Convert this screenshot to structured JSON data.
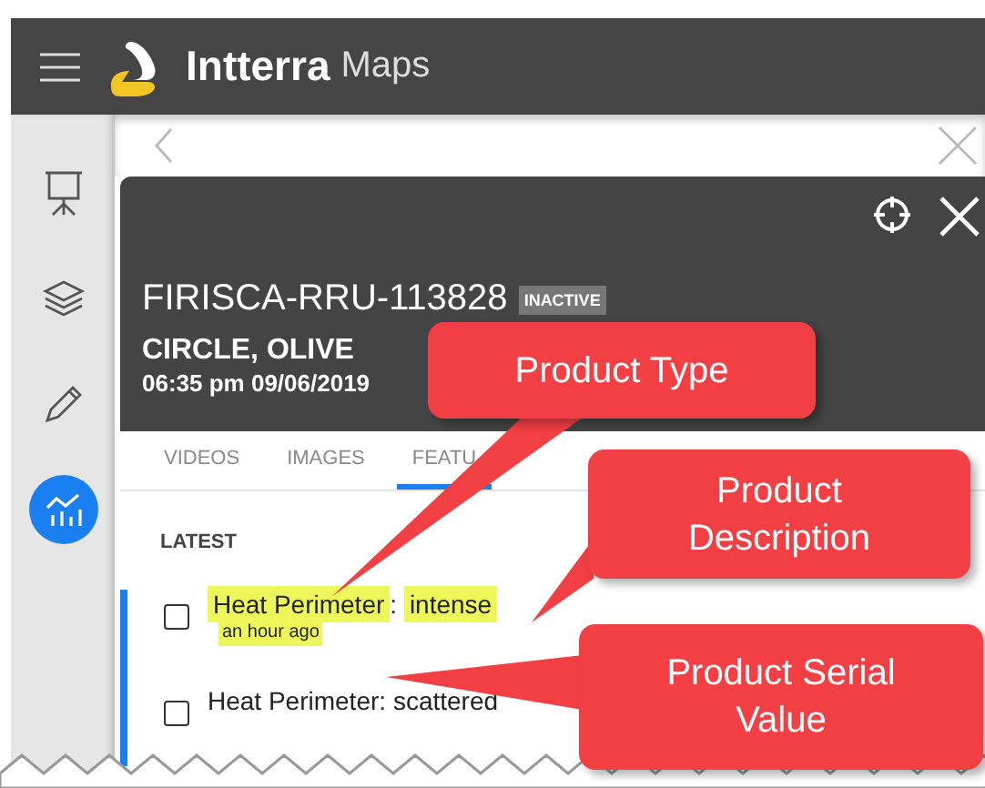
{
  "header": {
    "brand": "Intterra",
    "product": "Maps"
  },
  "sidebar": {
    "items": [
      {
        "kind": "presentation",
        "selected": false
      },
      {
        "kind": "layers",
        "selected": false
      },
      {
        "kind": "pencil",
        "selected": false
      },
      {
        "kind": "chart",
        "selected": true
      }
    ]
  },
  "incident": {
    "title": "FIRISCA-RRU-113828",
    "badge": "INACTIVE",
    "name": "CIRCLE, OLIVE",
    "time": "06:35 pm 09/06/2019"
  },
  "tabs": [
    {
      "label": "VIDEOS",
      "selected": false
    },
    {
      "label": "IMAGES",
      "selected": false
    },
    {
      "label": "FEATU",
      "selected": true
    }
  ],
  "section": "LATEST",
  "features": [
    {
      "type": "Heat Perimeter",
      "separator": ":",
      "description": "intense",
      "time": "an hour ago",
      "checked": false,
      "highlighted": true,
      "active": true
    },
    {
      "type": "Heat Perimeter",
      "separator": ":",
      "description": "scattered",
      "checked": false,
      "highlighted": false,
      "active": true
    }
  ],
  "callouts": [
    {
      "text": "Product Type"
    },
    {
      "text": "Product Description"
    },
    {
      "text": "Product Serial Value"
    }
  ]
}
